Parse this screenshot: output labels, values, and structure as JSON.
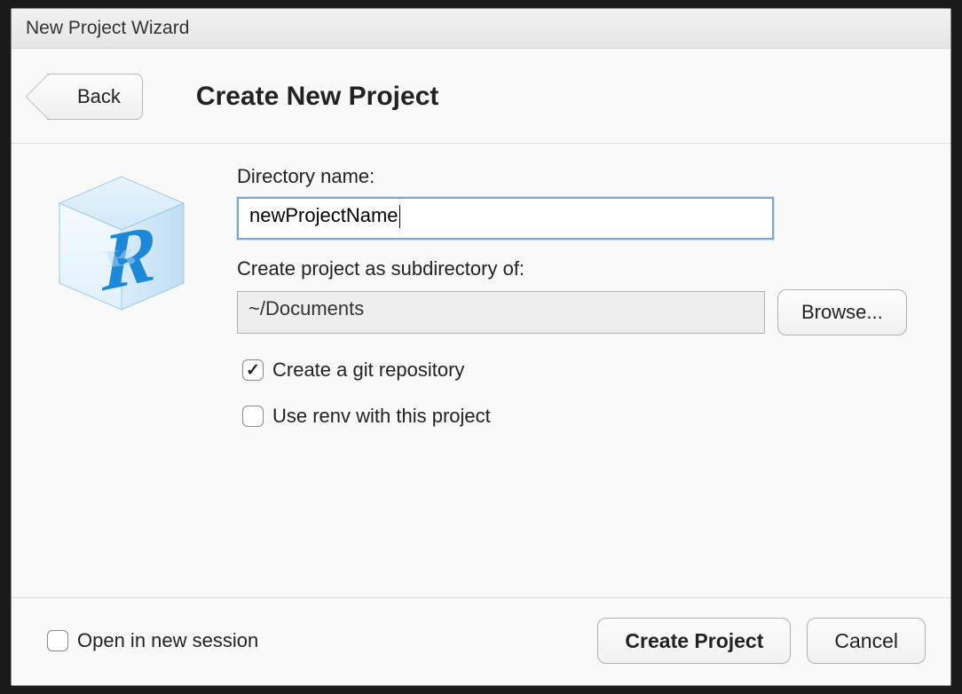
{
  "window": {
    "title": "New Project Wizard"
  },
  "header": {
    "back_label": "Back",
    "page_title": "Create New Project"
  },
  "form": {
    "directory_label": "Directory name:",
    "directory_value": "newProjectName",
    "subdir_label": "Create project as subdirectory of:",
    "subdir_value": "~/Documents",
    "browse_label": "Browse...",
    "git_checkbox_label": "Create a git repository",
    "git_checkbox_checked": true,
    "renv_checkbox_label": "Use renv with this project",
    "renv_checkbox_checked": false
  },
  "footer": {
    "open_session_label": "Open in new session",
    "open_session_checked": false,
    "create_label": "Create Project",
    "cancel_label": "Cancel"
  }
}
